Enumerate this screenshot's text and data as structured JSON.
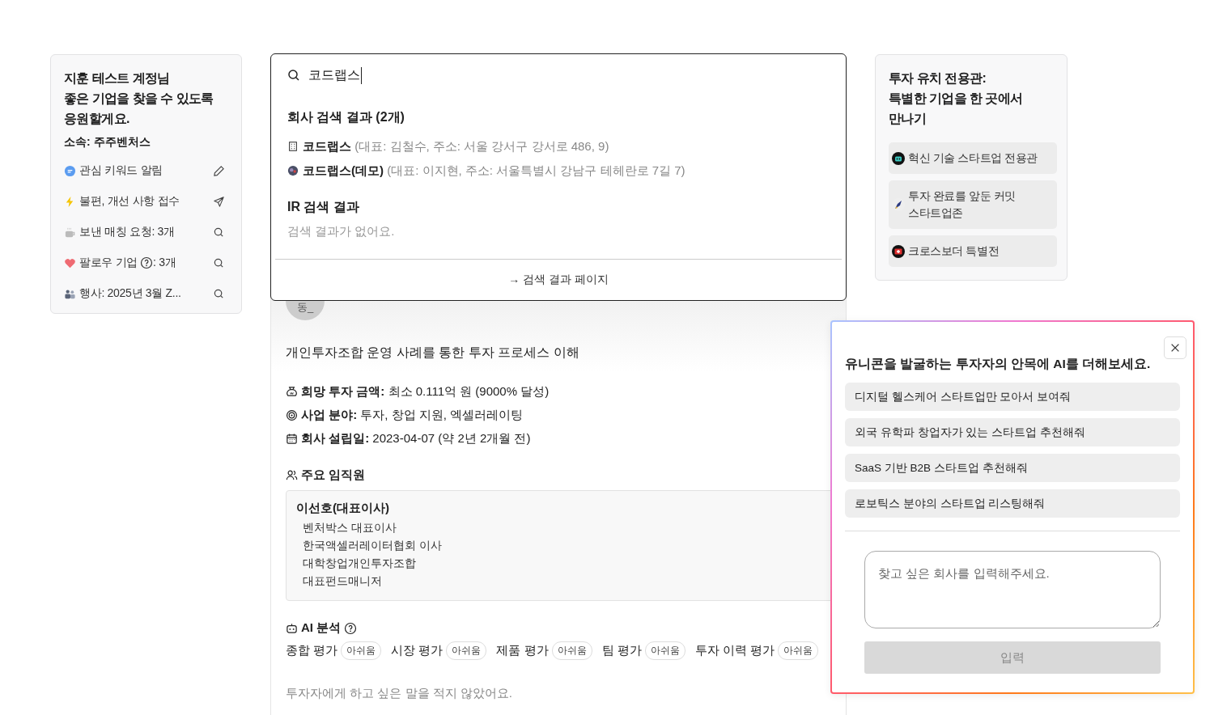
{
  "profile": {
    "greeting": "지훈 테스트 계정님\n좋은 기업을 찾을 수 있도록\n응원할게요.",
    "affiliation": "소속: 주주벤처스",
    "menu": [
      {
        "kind": "chat",
        "label": "관심 키워드 알림",
        "help": false
      },
      {
        "kind": "bolt",
        "label": "불편, 개선 사항 접수",
        "help": false
      },
      {
        "kind": "cup",
        "label": "보낸 매칭 요청: 3개",
        "help": false
      },
      {
        "kind": "heart",
        "label": "팔로우 기업",
        "help": true,
        "after": ": 3개"
      },
      {
        "kind": "people",
        "label": "행사: 2025년 3월 Z...",
        "help": false
      }
    ]
  },
  "search": {
    "query": "코드랩스",
    "company_heading": "회사 검색 결과 (2개)",
    "companies": [
      {
        "kind": "building",
        "name": "코드랩스",
        "detail": "(대표: 김철수, 주소: 서울 강서구 강서로 486, 9)"
      },
      {
        "kind": "logo",
        "name": "코드랩스(데모)",
        "detail": "(대표: 이지현, 주소: 서울특별시 강남구 테헤란로 7길 7)"
      }
    ],
    "ir_heading": "IR 검색 결과",
    "ir_empty": "검색 결과가 없어요.",
    "footer_link": "→ 검색 결과 페이지"
  },
  "company": {
    "avatar": "동_",
    "description": "개인투자조합 운영 사례를 통한 투자 프로세스 이해",
    "facts": [
      {
        "kind": "money",
        "label": "희망 투자 금액:",
        "value": "최소 0.111억 원 (9000% 달성)"
      },
      {
        "kind": "target",
        "label": "사업 분야:",
        "value": "투자, 창업 지원, 엑셀러레이팅"
      },
      {
        "kind": "calendar",
        "label": "회사 설립일:",
        "value": "2023-04-07 (약 2년 2개월 전)"
      }
    ],
    "staff_heading": "주요 임직원",
    "staff": [
      {
        "name": "이선호(대표이사)",
        "roles": [
          "벤처박스 대표이사",
          "한국액셀러레이터협회 이사",
          "대학창업개인투자조합",
          "대표펀드매니저"
        ]
      }
    ],
    "ai_heading": "AI 분석",
    "ratings": [
      {
        "label": "종합 평가",
        "grade": "아쉬움"
      },
      {
        "label": "시장 평가",
        "grade": "아쉬움"
      },
      {
        "label": "제품 평가",
        "grade": "아쉬움"
      },
      {
        "label": "팀 평가",
        "grade": "아쉬움"
      },
      {
        "label": "투자 이력 평가",
        "grade": "아쉬움"
      }
    ],
    "note": "투자자에게 하고 싶은 말을 적지 않았어요."
  },
  "showcase": {
    "title": "투자 유치 전용관:\n특별한 기업을 한 곳에서\n만나기",
    "items": [
      {
        "kind": "robot",
        "label": "혁신 기술 스타트업 전용관"
      },
      {
        "kind": "rocket",
        "label": "투자 완료를 앞둔 커밋\n스타트업존"
      },
      {
        "kind": "flag",
        "label": "크로스보더 특별전"
      }
    ]
  },
  "assistant": {
    "title": "유니콘을 발굴하는 투자자의 안목에 AI를 더해보세요.",
    "suggestions": [
      "디지털 헬스케어 스타트업만 모아서 보여줘",
      "외국 유학파 창업자가 있는 스타트업 추천해줘",
      "SaaS 기반 B2B 스타트업 추천해줘",
      "로보틱스 분야의 스타트업 리스팅해줘"
    ],
    "placeholder": "찾고 싶은 회사를 입력해주세요.",
    "submit": "입력",
    "submit_disabled": true
  }
}
